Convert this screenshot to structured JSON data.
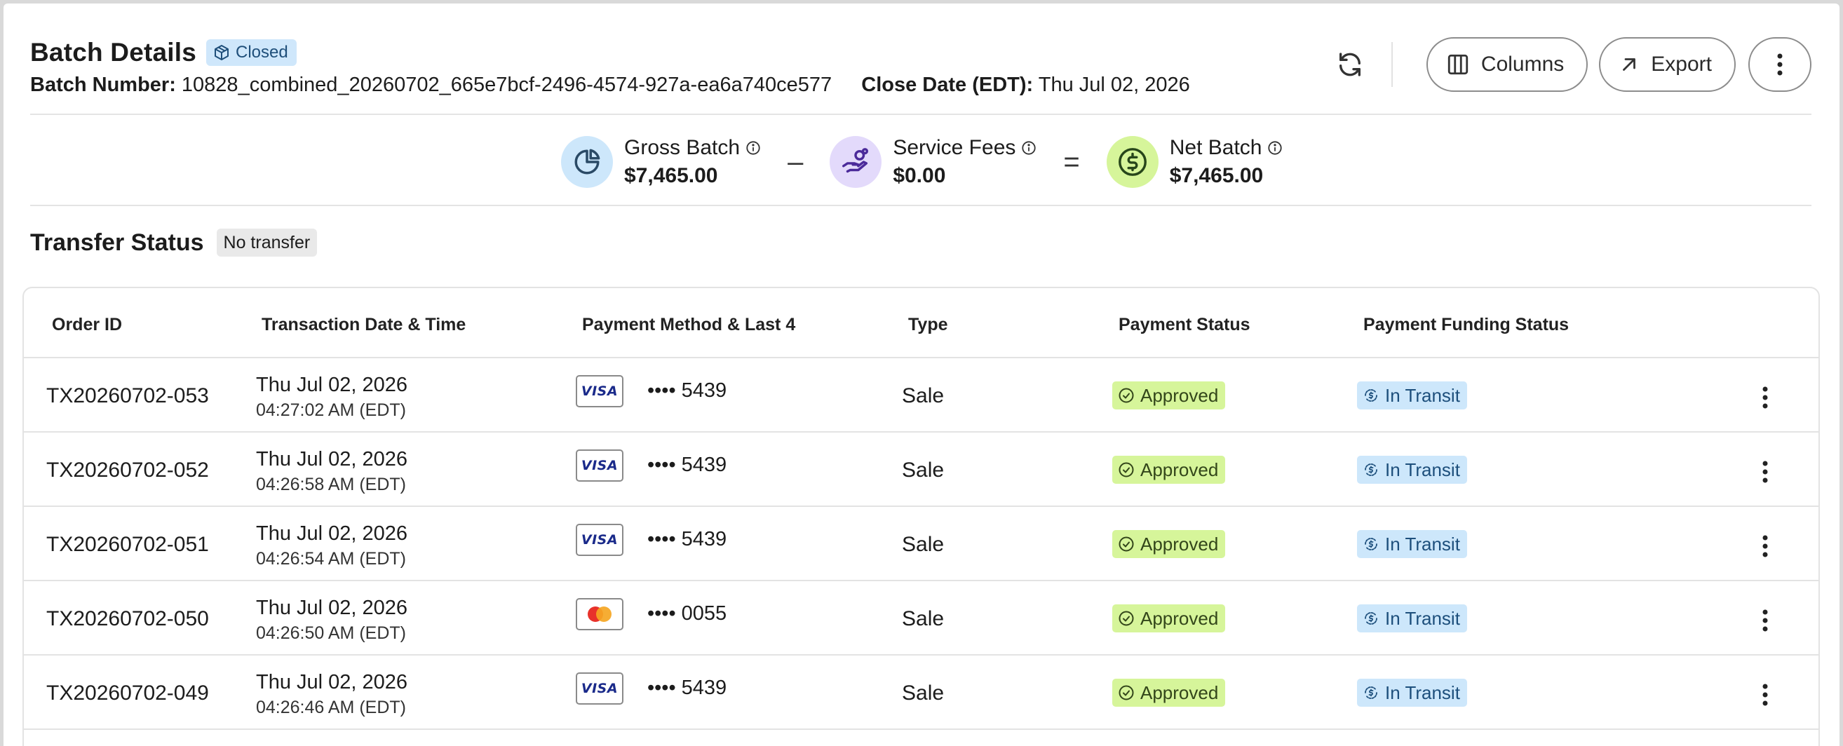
{
  "header": {
    "title": "Batch Details",
    "status_badge": "Closed",
    "batch_number_label": "Batch Number:",
    "batch_number": "10828_combined_20260702_665e7bcf-2496-4574-927a-ea6a740ce577",
    "close_date_label": "Close Date (EDT):",
    "close_date": "Thu Jul 02, 2026"
  },
  "actions": {
    "columns_label": "Columns",
    "export_label": "Export"
  },
  "summary": {
    "gross_label": "Gross Batch",
    "gross_value": "$7,465.00",
    "minus": "–",
    "fees_label": "Service Fees",
    "fees_value": "$0.00",
    "equals": "=",
    "net_label": "Net Batch",
    "net_value": "$7,465.00"
  },
  "transfer": {
    "title": "Transfer Status",
    "badge": "No transfer"
  },
  "table": {
    "headers": [
      "Order ID",
      "Transaction Date & Time",
      "Payment Method & Last 4",
      "Type",
      "Payment Status",
      "Payment Funding Status"
    ],
    "rows": [
      {
        "order_id": "TX20260702-053",
        "date": "Thu Jul 02, 2026",
        "time": "04:27:02 AM (EDT)",
        "card": "visa",
        "last4": "•••• 5439",
        "type": "Sale",
        "payment_status": "Approved",
        "funding_status": "In Transit"
      },
      {
        "order_id": "TX20260702-052",
        "date": "Thu Jul 02, 2026",
        "time": "04:26:58 AM (EDT)",
        "card": "visa",
        "last4": "•••• 5439",
        "type": "Sale",
        "payment_status": "Approved",
        "funding_status": "In Transit"
      },
      {
        "order_id": "TX20260702-051",
        "date": "Thu Jul 02, 2026",
        "time": "04:26:54 AM (EDT)",
        "card": "visa",
        "last4": "•••• 5439",
        "type": "Sale",
        "payment_status": "Approved",
        "funding_status": "In Transit"
      },
      {
        "order_id": "TX20260702-050",
        "date": "Thu Jul 02, 2026",
        "time": "04:26:50 AM (EDT)",
        "card": "mastercard",
        "last4": "•••• 0055",
        "type": "Sale",
        "payment_status": "Approved",
        "funding_status": "In Transit"
      },
      {
        "order_id": "TX20260702-049",
        "date": "Thu Jul 02, 2026",
        "time": "04:26:46 AM (EDT)",
        "card": "visa",
        "last4": "•••• 5439",
        "type": "Sale",
        "payment_status": "Approved",
        "funding_status": "In Transit"
      }
    ]
  },
  "card_labels": {
    "visa": "VISA"
  },
  "icons": {
    "status_badge": "box-icon",
    "refresh": "refresh-icon",
    "columns": "columns-icon",
    "export": "arrow-up-right-icon",
    "more": "kebab-vertical-icon",
    "gross": "pie-chart-icon",
    "fees": "hand-coins-icon",
    "net": "dollar-circle-icon",
    "info": "info-icon",
    "approved": "check-circle-icon",
    "transit": "dollar-cycle-icon"
  },
  "colors": {
    "closed_badge_bg": "#cfe7fb",
    "gross_circle": "#cde7fb",
    "fees_circle": "#e3dafb",
    "net_circle": "#d6f59a",
    "approved_bg": "#d6f59a",
    "transit_bg": "#cde7fb",
    "no_transfer_bg": "#e9e9e9"
  }
}
